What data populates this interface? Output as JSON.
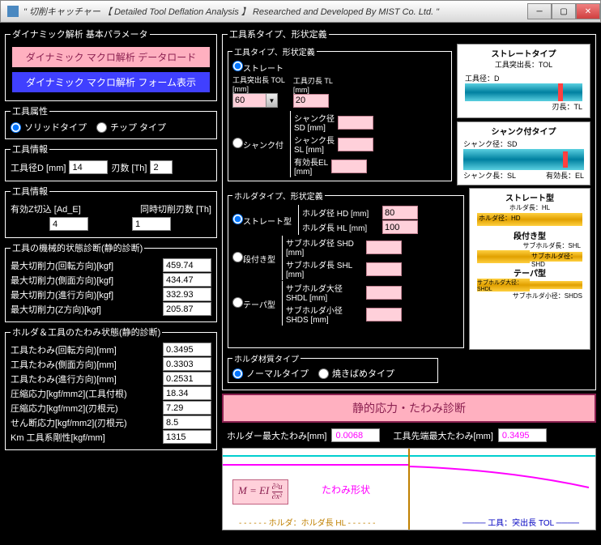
{
  "title": "\" 切削キャッチャー   【  Detailed Tool Deflation Analysis  】   Researched and Developed By MIST Co. Ltd. \"",
  "left": {
    "dynamic_group": "ダイナミック解析  基本パラメータ",
    "btn_pink": "ダイナミック マクロ解析  データロード",
    "btn_blue": "ダイナミック マクロ解析  フォーム表示",
    "tool_attr_group": "工具属性",
    "radio_solid": "ソリッドタイプ",
    "radio_tip": "チップ タイプ",
    "tool_info1_group": "工具情報",
    "diam_label": "工具径D [mm]",
    "diam_value": "14",
    "teeth_label": "刃数 [Th]",
    "teeth_value": "2",
    "tool_info2_group": "工具情報",
    "adE_label": "有効Z切込 [Ad_E]",
    "adE_value": "4",
    "simTeeth_label": "同時切削刃数 [Th]",
    "simTeeth_value": "1",
    "mech_group": "工具の機械的状態診断(静的診断)",
    "mech_rows": [
      {
        "label": "最大切削力(回転方向)[kgf]",
        "value": "459.74"
      },
      {
        "label": "最大切削力(側面方向)[kgf]",
        "value": "434.47"
      },
      {
        "label": "最大切削力(進行方向)[kgf]",
        "value": "332.93"
      },
      {
        "label": "最大切削力(Z方向)[kgf]",
        "value": "205.87"
      }
    ],
    "defl_group": "ホルダ＆工具のたわみ状態(静的診断)",
    "defl_rows": [
      {
        "label": "工具たわみ(回転方向)[mm]",
        "value": "0.3495"
      },
      {
        "label": "工具たわみ(側面方向)[mm]",
        "value": "0.3303"
      },
      {
        "label": "工具たわみ(進行方向)[mm]",
        "value": "0.2531"
      },
      {
        "label": "圧縮応力[kgf/mm2](工具付根)",
        "value": "18.34"
      },
      {
        "label": "圧縮応力[kgf/mm2](刃根元)",
        "value": "7.29"
      },
      {
        "label": "せん断応力[kgf/mm2](刃根元)",
        "value": "8.5"
      },
      {
        "label": "Km 工具系剛性[kgf/mm]",
        "value": "1315"
      }
    ]
  },
  "right": {
    "sys_group": "工具系タイプ、形状定義",
    "tool_shape_group": "工具タイプ、形状定義",
    "radio_straight": "ストレート",
    "tol_label": "工具突出長 TOL\n[mm]",
    "tol_value": "60",
    "tl_label": "工具刃長 TL\n[mm]",
    "tl_value": "20",
    "radio_shank": "シャンク付",
    "sd_label": "シャンク径\nSD [mm]",
    "sl_label": "シャンク長\nSL [mm]",
    "el_label": "有効長EL\n[mm]",
    "straight_title": "ストレートタイプ",
    "straight_tol_label": "工具突出長：TOL",
    "straight_d_label": "工具径：D",
    "straight_tl_label": "刃長：TL",
    "shank_title": "シャンク付タイプ",
    "shank_sd_label": "シャンク径：SD",
    "shank_sl_label": "シャンク長：SL",
    "shank_el_label": "有効長：EL",
    "holder_group": "ホルダタイプ、形状定義",
    "radio_h_straight": "ストレート型",
    "hd_label": "ホルダ径 HD [mm]",
    "hd_value": "80",
    "hl_label": "ホルダ長 HL [mm]",
    "hl_value": "100",
    "radio_h_step": "段付き型",
    "shd_label": "サブホルダ径 SHD\n[mm]",
    "shl_label": "サブホルダ長 SHL\n[mm]",
    "radio_h_taper": "テーパ型",
    "shdl_label": "サブホルダ大径\nSHDL [mm]",
    "shds_label": "サブホルダ小径\nSHDS [mm]",
    "h_diag_straight_title": "ストレート型",
    "h_diag_straight_hl": "ホルダ長：HL",
    "h_diag_straight_hd": "ホルダ径：HD",
    "h_diag_step_title": "段付き型",
    "h_diag_step_shl": "サブホルダ長：SHL",
    "h_diag_step_shd": "サブホルダ径：SHD",
    "h_diag_taper_title": "テーパ型",
    "h_diag_taper_shdl": "サブホルダ大径：SHDL",
    "h_diag_taper_shds": "サブホルダ小径：SHDS",
    "mat_group": "ホルダ材質タイプ",
    "radio_mat_normal": "ノーマルタイプ",
    "radio_mat_shrink": "焼きばめタイプ",
    "big_btn": "静的応力・たわみ診断",
    "res_holder_label": "ホルダー最大たわみ[mm]",
    "res_holder_value": "0.0068",
    "res_tool_label": "工具先端最大たわみ[mm]",
    "res_tool_value": "0.3495",
    "formula": "M = EI ∂²u/∂x²",
    "formula_label": "たわみ形状",
    "legend_holder": "ホルダ：ホルダ長 HL",
    "legend_tool": "工具：突出長 TOL"
  }
}
